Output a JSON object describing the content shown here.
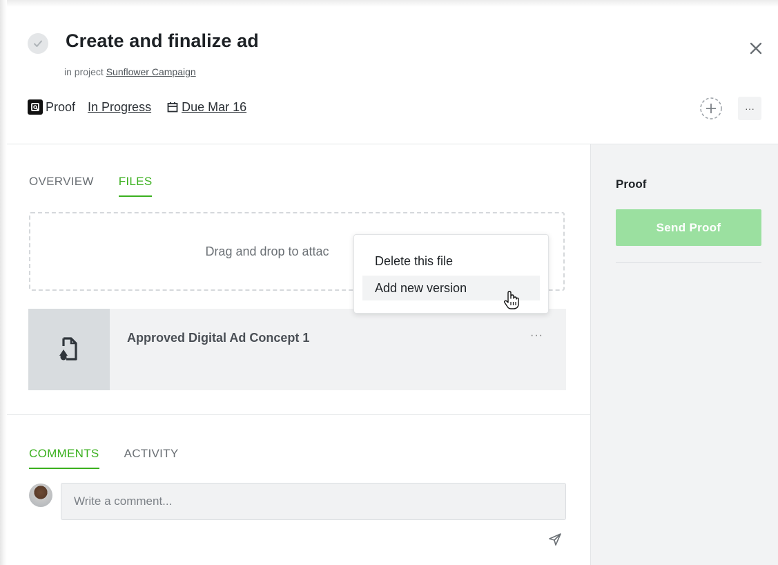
{
  "task": {
    "title": "Create and finalize ad",
    "project_prefix": "in project",
    "project_name": "Sunflower Campaign",
    "type_label": "Proof",
    "status": "In Progress",
    "due": "Due Mar 16"
  },
  "header": {
    "close_icon": "close-icon",
    "add_icon": "add-circle-icon",
    "more_label": "···"
  },
  "tabs": [
    {
      "label": "OVERVIEW",
      "active": false
    },
    {
      "label": "FILES",
      "active": true
    }
  ],
  "dropzone": {
    "text": "Drag and drop to attac"
  },
  "file": {
    "name": "Approved Digital Ad Concept 1",
    "more_label": "···"
  },
  "context_menu": {
    "items": [
      {
        "label": "Delete this file"
      },
      {
        "label": "Add new version",
        "hovered": true
      }
    ]
  },
  "comment_tabs": [
    {
      "label": "COMMENTS",
      "active": true
    },
    {
      "label": "ACTIVITY",
      "active": false
    }
  ],
  "comment": {
    "placeholder": "Write a comment..."
  },
  "sidebar": {
    "title": "Proof",
    "button_label": "Send Proof"
  },
  "colors": {
    "accent": "#3ab01e",
    "send_button": "#9be0a0"
  }
}
